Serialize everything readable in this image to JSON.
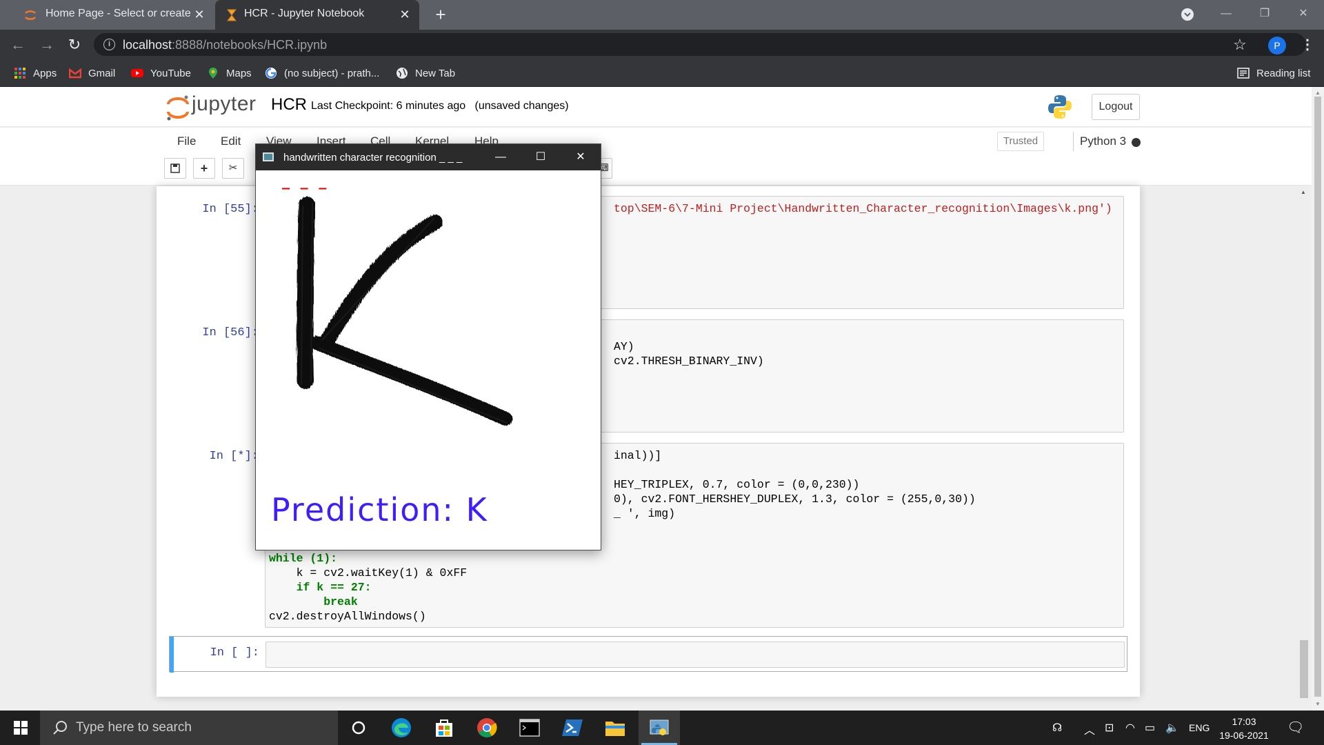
{
  "browser": {
    "tabs": [
      {
        "title": "Home Page - Select or create a n",
        "active": false
      },
      {
        "title": "HCR - Jupyter Notebook",
        "active": true
      }
    ],
    "new_tab_symbol": "+",
    "url_host": "localhost",
    "url_path": ":8888/notebooks/HCR.ipynb",
    "profile_initial": "P",
    "bookmarks": [
      {
        "label": "Apps",
        "icon": "apps-grid-icon"
      },
      {
        "label": "Gmail",
        "icon": "gmail-icon"
      },
      {
        "label": "YouTube",
        "icon": "youtube-icon"
      },
      {
        "label": "Maps",
        "icon": "maps-pin-icon"
      },
      {
        "label": "(no subject) - prath...",
        "icon": "google-icon"
      },
      {
        "label": "New Tab",
        "icon": "globe-icon"
      }
    ],
    "reading_list": "Reading list"
  },
  "jupyter": {
    "wordmark": "jupyter",
    "notebook_name": "HCR",
    "checkpoint": "Last Checkpoint: 6 minutes ago",
    "status": "(unsaved changes)",
    "logout": "Logout",
    "menu": [
      "File",
      "Edit",
      "View",
      "Insert",
      "Cell",
      "Kernel",
      "Help"
    ],
    "trusted": "Trusted",
    "kernel": "Python 3"
  },
  "cells": [
    {
      "prompt": "In [55]:",
      "lines_visible": [
        "top\\SEM-6\\7-Mini Project\\Handwritten_Character_recognition\\Images\\k.png')"
      ]
    },
    {
      "prompt": "In [56]:",
      "lines_visible": [
        "AY)",
        "cv2.THRESH_BINARY_INV)"
      ]
    },
    {
      "prompt": "In [*]:",
      "lines_visible": [
        "inal))]",
        "HEY_TRIPLEX, 0.7, color = (0,0,230))",
        "0), cv2.FONT_HERSHEY_DUPLEX, 1.3, color = (255,0,30))",
        "_ ', img)",
        "while (1):",
        "    k = cv2.waitKey(1) & 0xFF",
        "    if k == 27:",
        "        break",
        "cv2.destroyAllWindows()"
      ]
    },
    {
      "prompt": "In [ ]:",
      "lines_visible": []
    }
  ],
  "cv_window": {
    "title": "handwritten character recognition _ _ _",
    "dashes": "_ _ _",
    "prediction": "Prediction: K",
    "prediction_color": "#3c1eff",
    "dash_color": "#e60000",
    "drawn_letter": "K"
  },
  "taskbar": {
    "search_placeholder": "Type here to search",
    "language": "ENG",
    "time": "17:03",
    "date": "19-06-2021"
  }
}
